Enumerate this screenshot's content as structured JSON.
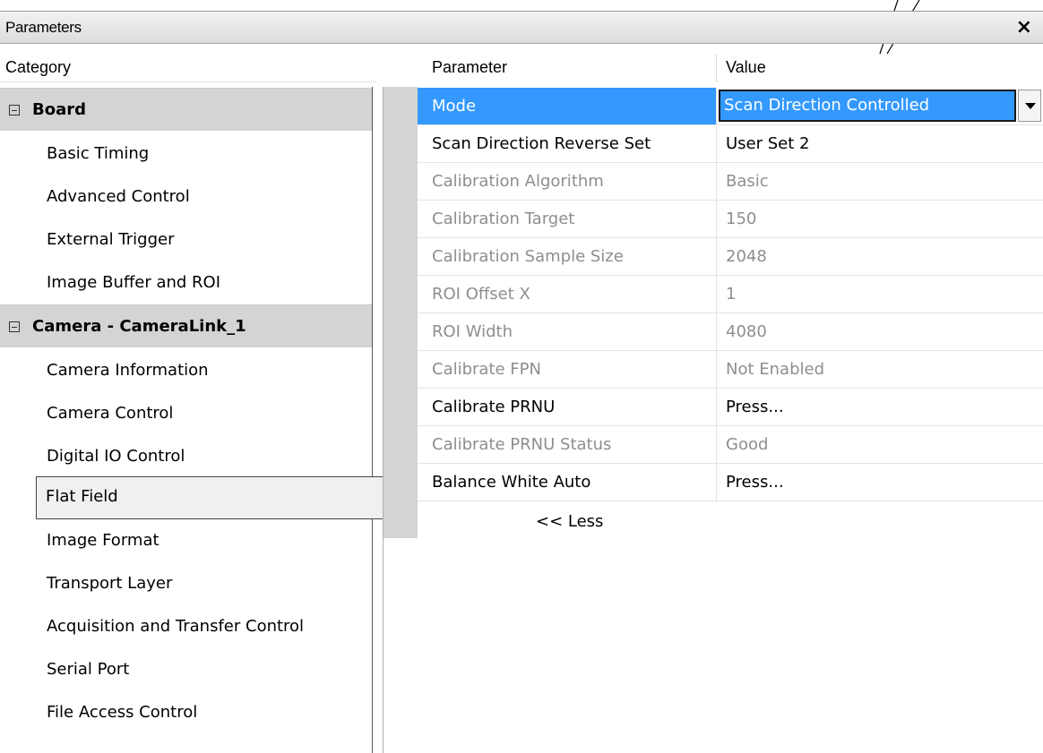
{
  "window": {
    "title": "Parameters",
    "close_label": "×"
  },
  "headers": {
    "category": "Category",
    "parameter": "Parameter",
    "value": "Value"
  },
  "categories": {
    "board": {
      "label": "Board",
      "items": [
        "Basic Timing",
        "Advanced Control",
        "External Trigger",
        "Image Buffer and ROI"
      ]
    },
    "camera": {
      "label": "Camera - CameraLink_1",
      "items": [
        "Camera Information",
        "Camera Control",
        "Digital IO Control",
        "Flat Field",
        "Image Format",
        "Transport Layer",
        "Acquisition and Transfer Control",
        "Serial Port",
        "File Access Control"
      ],
      "selected": "Flat Field"
    }
  },
  "parameters": [
    {
      "name": "Mode",
      "value": "Scan Direction Controlled",
      "state": "selected"
    },
    {
      "name": "Scan Direction Reverse Set",
      "value": "User Set 2",
      "state": "enabled"
    },
    {
      "name": "Calibration Algorithm",
      "value": "Basic",
      "state": "disabled"
    },
    {
      "name": "Calibration Target",
      "value": "150",
      "state": "disabled"
    },
    {
      "name": "Calibration Sample Size",
      "value": "2048",
      "state": "disabled"
    },
    {
      "name": "ROI Offset X",
      "value": "1",
      "state": "disabled"
    },
    {
      "name": "ROI Width",
      "value": "4080",
      "state": "disabled"
    },
    {
      "name": "Calibrate FPN",
      "value": "Not Enabled",
      "state": "disabled"
    },
    {
      "name": "Calibrate PRNU",
      "value": "Press...",
      "state": "enabled"
    },
    {
      "name": "Calibrate PRNU Status",
      "value": "Good",
      "state": "disabled"
    },
    {
      "name": "Balance White Auto",
      "value": "Press...",
      "state": "enabled"
    }
  ],
  "less_button": "<< Less",
  "colors": {
    "selection": "#3399ff",
    "group_bg": "#d4d4d4",
    "disabled_text": "#8e8e8e"
  }
}
